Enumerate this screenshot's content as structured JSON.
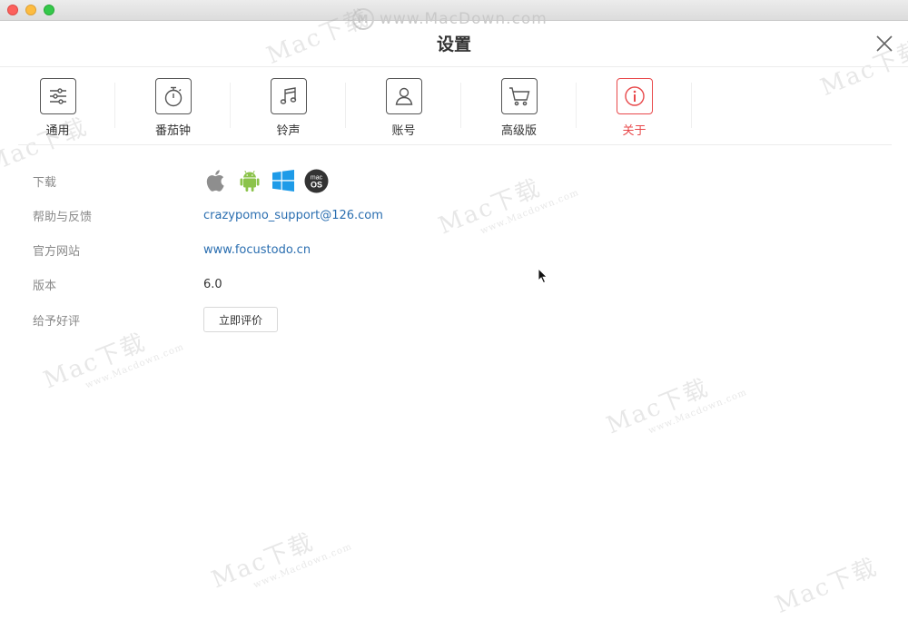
{
  "window": {
    "title": "设置"
  },
  "watermark": {
    "text": "www.MacDown.com",
    "logo": "M",
    "brand": "Mac下载",
    "site": "www.Macdown.com"
  },
  "tabs": [
    {
      "label": "通用",
      "icon": "sliders-icon",
      "active": false
    },
    {
      "label": "番茄钟",
      "icon": "stopwatch-icon",
      "active": false
    },
    {
      "label": "铃声",
      "icon": "music-note-icon",
      "active": false
    },
    {
      "label": "账号",
      "icon": "user-icon",
      "active": false
    },
    {
      "label": "高级版",
      "icon": "cart-icon",
      "active": false
    },
    {
      "label": "关于",
      "icon": "info-icon",
      "active": true
    }
  ],
  "about": {
    "download": {
      "label": "下载",
      "platforms": [
        "apple-icon",
        "android-icon",
        "windows-icon",
        "macos-icon"
      ],
      "macos_text": [
        "mac",
        "OS"
      ]
    },
    "feedback": {
      "label": "帮助与反馈",
      "value": "crazypomo_support@126.com"
    },
    "website": {
      "label": "官方网站",
      "value": "www.focustodo.cn"
    },
    "version": {
      "label": "版本",
      "value": "6.0"
    },
    "rate": {
      "label": "给予好评",
      "button": "立即评价"
    }
  },
  "colors": {
    "accent": "#e8484a",
    "link": "#2a6eb0",
    "android": "#8bc34a",
    "windows": "#1e9be8"
  }
}
